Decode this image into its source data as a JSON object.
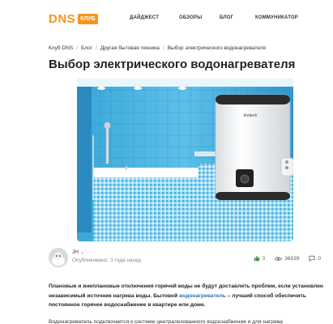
{
  "header": {
    "logo_text": "DNS",
    "logo_badge": "КЛУБ",
    "nav": [
      "ДАЙДЖЕСТ",
      "ОБЗОРЫ",
      "БЛОГ",
      "КОММУНИКАТОР"
    ]
  },
  "breadcrumb": [
    "Клуб DNS",
    "Блог",
    "Другая бытовая техника",
    "Выбор электрического водонагревателя"
  ],
  "article": {
    "title": "Выбор электрического водонагревателя",
    "author": "JH",
    "published": "Опубликовано: 3 года назад",
    "likes": "3",
    "views": "36539",
    "comments": "0",
    "boiler_brand": "timberk",
    "lead_part1": "Плановые и внеплановые отключения горячей воды не будут доставлять проблем, если установлен независимый источник нагрева воды. Бытовой ",
    "lead_link": "водонагреватель",
    "lead_part2": " – лучший способ обеспечить постоянное горячее водоснабжение в квартире или доме.",
    "para": "Водонагреватель подключается к системе централизованного водоснабжения и для нагрева"
  },
  "colors": {
    "brand": "#f7941d",
    "link": "#1e73be",
    "like": "#3a9a3a"
  }
}
